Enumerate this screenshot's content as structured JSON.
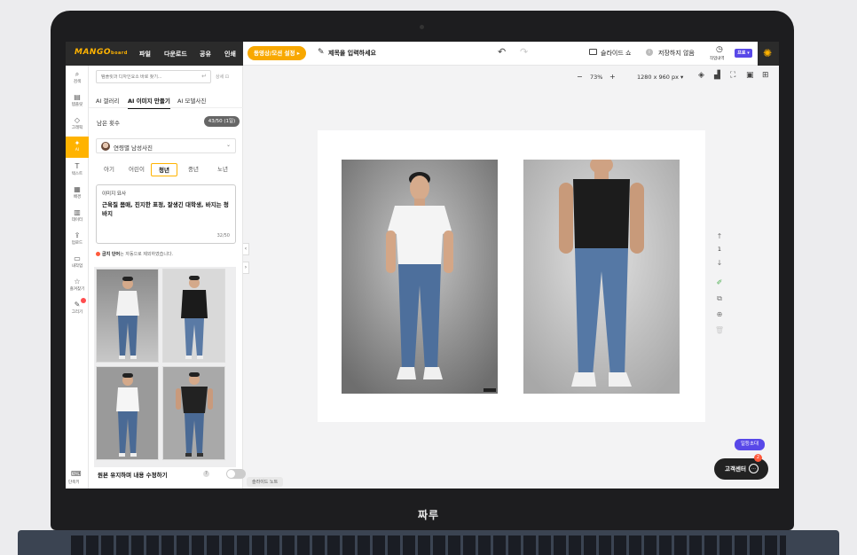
{
  "device": {
    "brand_label": "짜루"
  },
  "topbar": {
    "logo": "MANGO",
    "logo_sub": "board",
    "menu": [
      "파일",
      "다운로드",
      "공유",
      "인쇄"
    ],
    "video_button": "동영상/모션 설정 ▸",
    "title_placeholder": "제목을 입력하세요",
    "slideshow_label": "슬라이드 쇼",
    "save_status": "저장하지 않음",
    "history_label": "작업내역",
    "pro_badge": "프로 ▾"
  },
  "rail": {
    "items": [
      {
        "label": "검색",
        "icon": "search-icon",
        "glyph": "⌕"
      },
      {
        "label": "템플릿",
        "icon": "template-icon",
        "glyph": "▤"
      },
      {
        "label": "그래픽",
        "icon": "graphic-icon",
        "glyph": "◇"
      },
      {
        "label": "AI",
        "icon": "ai-icon",
        "glyph": "✦",
        "active": true
      },
      {
        "label": "텍스트",
        "icon": "text-icon",
        "glyph": "T"
      },
      {
        "label": "배경",
        "icon": "background-icon",
        "glyph": "▦"
      },
      {
        "label": "데이터",
        "icon": "chart-icon",
        "glyph": "▥"
      },
      {
        "label": "업로드",
        "icon": "upload-icon",
        "glyph": "⇪"
      },
      {
        "label": "내작업",
        "icon": "folder-icon",
        "glyph": "▭"
      },
      {
        "label": "즐겨찾기",
        "icon": "star-icon",
        "glyph": "☆"
      },
      {
        "label": "그리기",
        "icon": "draw-icon",
        "glyph": "✎"
      }
    ],
    "shortcut_label": "단축키"
  },
  "panel": {
    "search_placeholder": "템플릿과 디자인요소 바로 찾기...",
    "detail_link": "상세 ⊡",
    "tabs": [
      "AI 갤러리",
      "AI 이미지 만들기",
      "AI 모델사진"
    ],
    "active_tab": 1,
    "remaining_label": "남은 횟수",
    "remaining_value": "43/50 (1일)",
    "preset_label": "연령별 남성사진",
    "age_segments": [
      "아기",
      "어린이",
      "청년",
      "중년",
      "노년"
    ],
    "active_age": 2,
    "description_label": "이미지 묘사",
    "description_text": "근육질 몸매, 진지한 표정, 잘생긴 대학생, 바지는 청바지",
    "description_count": "32/50",
    "notice_bold": "금지 단어",
    "notice_rest": "는 자동으로 제외하였습니다.",
    "keep_content_label": "원본 유지하며 내용 수정하기",
    "keep_content_on": false
  },
  "canvas": {
    "zoom_minus": "−",
    "zoom_value": "73%",
    "zoom_plus": "+",
    "canvas_size": "1280 x 960 px ▾",
    "page_number": "1",
    "slide_note": "슬라이드 노트"
  },
  "support": {
    "invite_badge": "일등초대",
    "button_label": "고객센터",
    "unread_count": "2"
  },
  "colors": {
    "accent": "#ffb300",
    "dark": "#2b2b2b",
    "pro": "#5848e8"
  }
}
